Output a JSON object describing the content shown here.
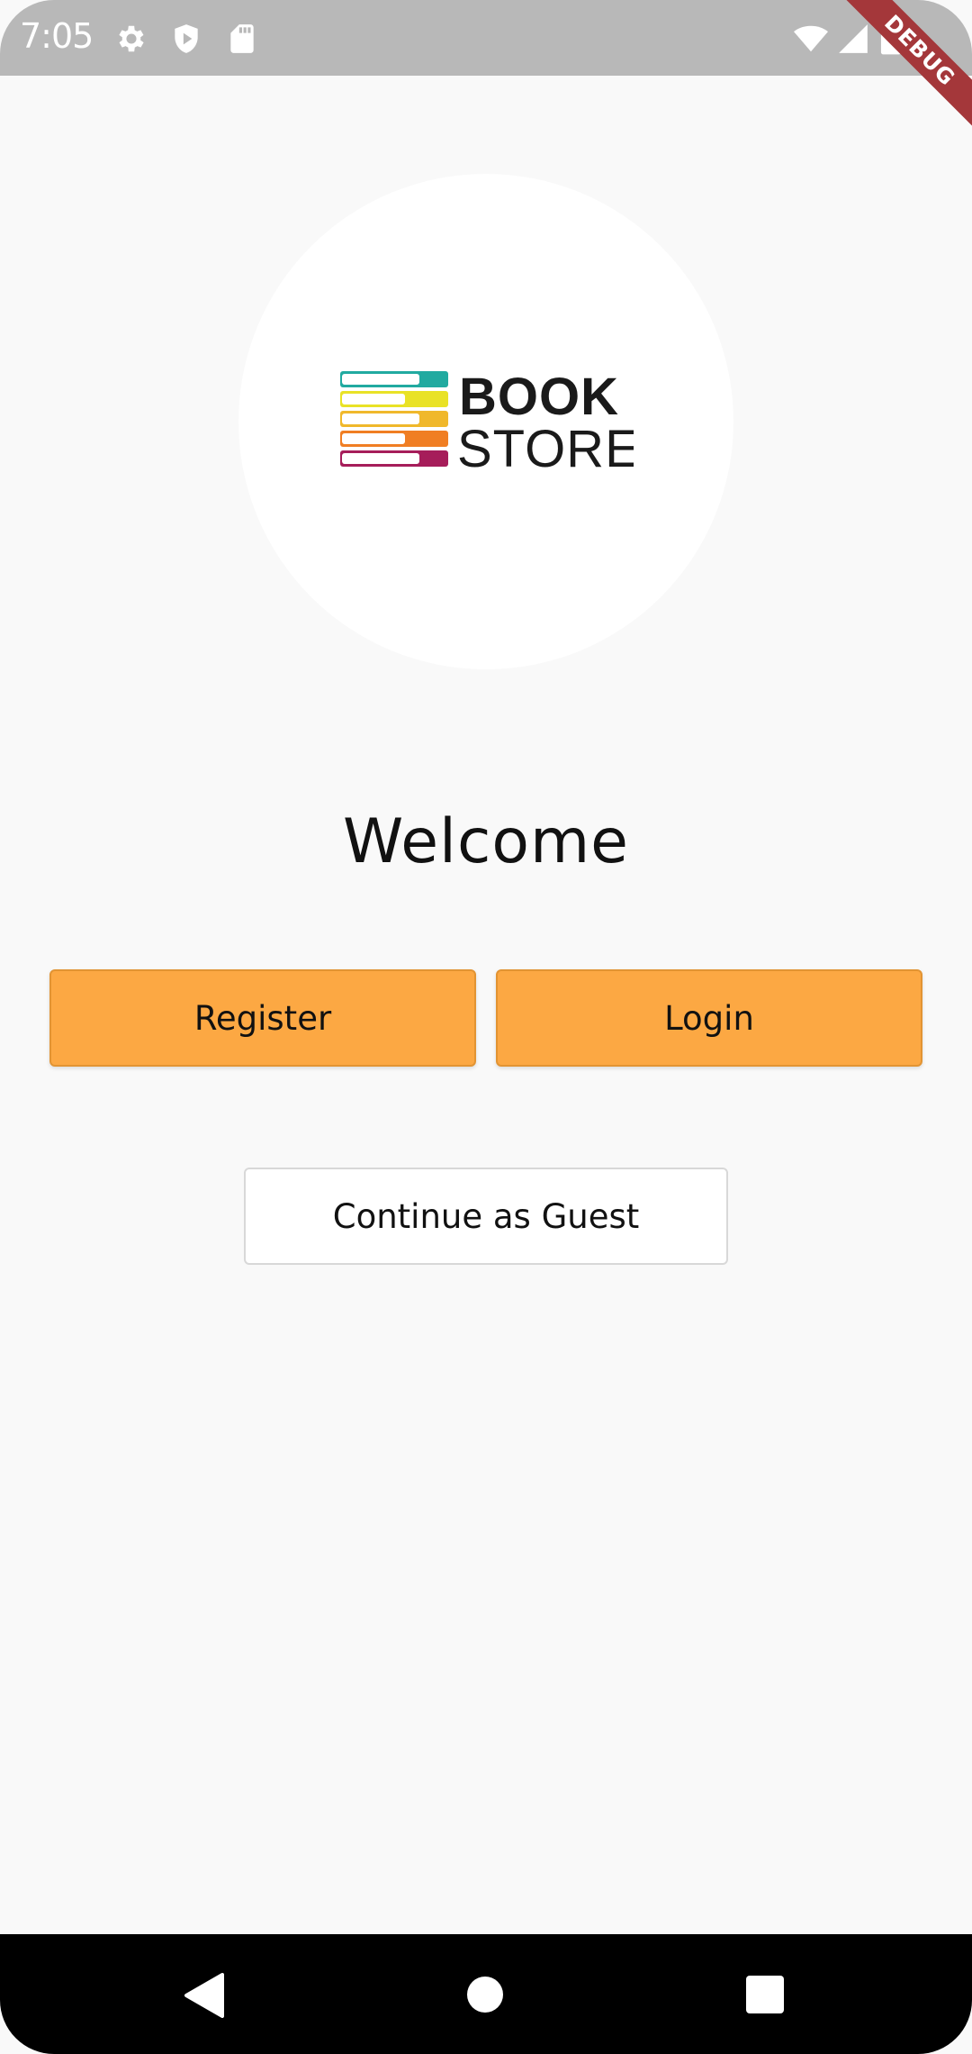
{
  "status_bar": {
    "time": "7:05",
    "left_icons": [
      "gear-icon",
      "shield-play-icon",
      "sd-card-icon"
    ],
    "right_icons": [
      "wifi-icon",
      "cell-signal-icon",
      "battery-icon"
    ]
  },
  "debug_banner": {
    "label": "DEBUG"
  },
  "logo": {
    "line1": "BOOK",
    "line2": "STORE",
    "stripe_colors": [
      "#21aaa0",
      "#e9e226",
      "#f0b82b",
      "#f07e23",
      "#a61d5a"
    ]
  },
  "welcome": {
    "title": "Welcome"
  },
  "actions": {
    "register_label": "Register",
    "login_label": "Login",
    "guest_label": "Continue as Guest"
  },
  "colors": {
    "primary_button": "#fca843",
    "background": "#f9f9f9",
    "status_bar": "#b8b8b8"
  },
  "nav_bar": {
    "icons": [
      "back-icon",
      "home-icon",
      "recents-icon"
    ]
  }
}
